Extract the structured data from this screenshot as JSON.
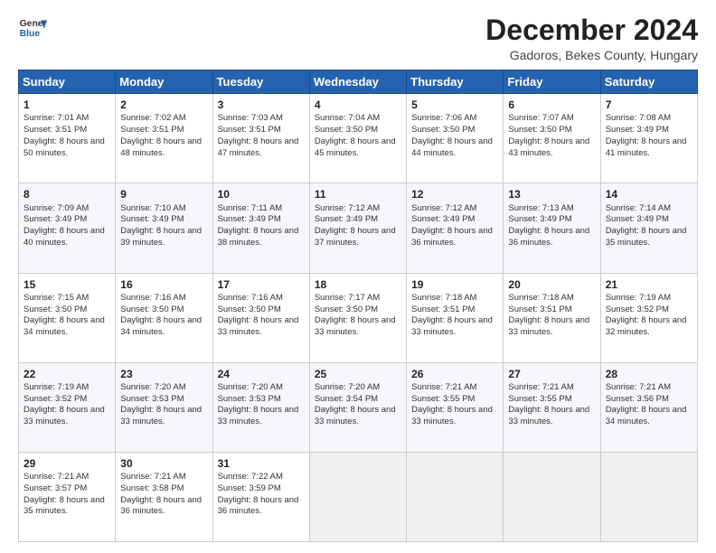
{
  "header": {
    "logo": {
      "line1": "General",
      "line2": "Blue"
    },
    "title": "December 2024",
    "subtitle": "Gadoros, Bekes County, Hungary"
  },
  "calendar": {
    "headers": [
      "Sunday",
      "Monday",
      "Tuesday",
      "Wednesday",
      "Thursday",
      "Friday",
      "Saturday"
    ],
    "weeks": [
      [
        null,
        null,
        null,
        null,
        null,
        null,
        null
      ]
    ],
    "days": {
      "1": {
        "sunrise": "7:01 AM",
        "sunset": "3:51 PM",
        "daylight": "8 hours and 50 minutes"
      },
      "2": {
        "sunrise": "7:02 AM",
        "sunset": "3:51 PM",
        "daylight": "8 hours and 48 minutes"
      },
      "3": {
        "sunrise": "7:03 AM",
        "sunset": "3:51 PM",
        "daylight": "8 hours and 47 minutes"
      },
      "4": {
        "sunrise": "7:04 AM",
        "sunset": "3:50 PM",
        "daylight": "8 hours and 45 minutes"
      },
      "5": {
        "sunrise": "7:06 AM",
        "sunset": "3:50 PM",
        "daylight": "8 hours and 44 minutes"
      },
      "6": {
        "sunrise": "7:07 AM",
        "sunset": "3:50 PM",
        "daylight": "8 hours and 43 minutes"
      },
      "7": {
        "sunrise": "7:08 AM",
        "sunset": "3:49 PM",
        "daylight": "8 hours and 41 minutes"
      },
      "8": {
        "sunrise": "7:09 AM",
        "sunset": "3:49 PM",
        "daylight": "8 hours and 40 minutes"
      },
      "9": {
        "sunrise": "7:10 AM",
        "sunset": "3:49 PM",
        "daylight": "8 hours and 39 minutes"
      },
      "10": {
        "sunrise": "7:11 AM",
        "sunset": "3:49 PM",
        "daylight": "8 hours and 38 minutes"
      },
      "11": {
        "sunrise": "7:12 AM",
        "sunset": "3:49 PM",
        "daylight": "8 hours and 37 minutes"
      },
      "12": {
        "sunrise": "7:12 AM",
        "sunset": "3:49 PM",
        "daylight": "8 hours and 36 minutes"
      },
      "13": {
        "sunrise": "7:13 AM",
        "sunset": "3:49 PM",
        "daylight": "8 hours and 36 minutes"
      },
      "14": {
        "sunrise": "7:14 AM",
        "sunset": "3:49 PM",
        "daylight": "8 hours and 35 minutes"
      },
      "15": {
        "sunrise": "7:15 AM",
        "sunset": "3:50 PM",
        "daylight": "8 hours and 34 minutes"
      },
      "16": {
        "sunrise": "7:16 AM",
        "sunset": "3:50 PM",
        "daylight": "8 hours and 34 minutes"
      },
      "17": {
        "sunrise": "7:16 AM",
        "sunset": "3:50 PM",
        "daylight": "8 hours and 33 minutes"
      },
      "18": {
        "sunrise": "7:17 AM",
        "sunset": "3:50 PM",
        "daylight": "8 hours and 33 minutes"
      },
      "19": {
        "sunrise": "7:18 AM",
        "sunset": "3:51 PM",
        "daylight": "8 hours and 33 minutes"
      },
      "20": {
        "sunrise": "7:18 AM",
        "sunset": "3:51 PM",
        "daylight": "8 hours and 33 minutes"
      },
      "21": {
        "sunrise": "7:19 AM",
        "sunset": "3:52 PM",
        "daylight": "8 hours and 32 minutes"
      },
      "22": {
        "sunrise": "7:19 AM",
        "sunset": "3:52 PM",
        "daylight": "8 hours and 33 minutes"
      },
      "23": {
        "sunrise": "7:20 AM",
        "sunset": "3:53 PM",
        "daylight": "8 hours and 33 minutes"
      },
      "24": {
        "sunrise": "7:20 AM",
        "sunset": "3:53 PM",
        "daylight": "8 hours and 33 minutes"
      },
      "25": {
        "sunrise": "7:20 AM",
        "sunset": "3:54 PM",
        "daylight": "8 hours and 33 minutes"
      },
      "26": {
        "sunrise": "7:21 AM",
        "sunset": "3:55 PM",
        "daylight": "8 hours and 33 minutes"
      },
      "27": {
        "sunrise": "7:21 AM",
        "sunset": "3:55 PM",
        "daylight": "8 hours and 33 minutes"
      },
      "28": {
        "sunrise": "7:21 AM",
        "sunset": "3:56 PM",
        "daylight": "8 hours and 34 minutes"
      },
      "29": {
        "sunrise": "7:21 AM",
        "sunset": "3:57 PM",
        "daylight": "8 hours and 35 minutes"
      },
      "30": {
        "sunrise": "7:21 AM",
        "sunset": "3:58 PM",
        "daylight": "8 hours and 36 minutes"
      },
      "31": {
        "sunrise": "7:22 AM",
        "sunset": "3:59 PM",
        "daylight": "8 hours and 36 minutes"
      }
    }
  }
}
